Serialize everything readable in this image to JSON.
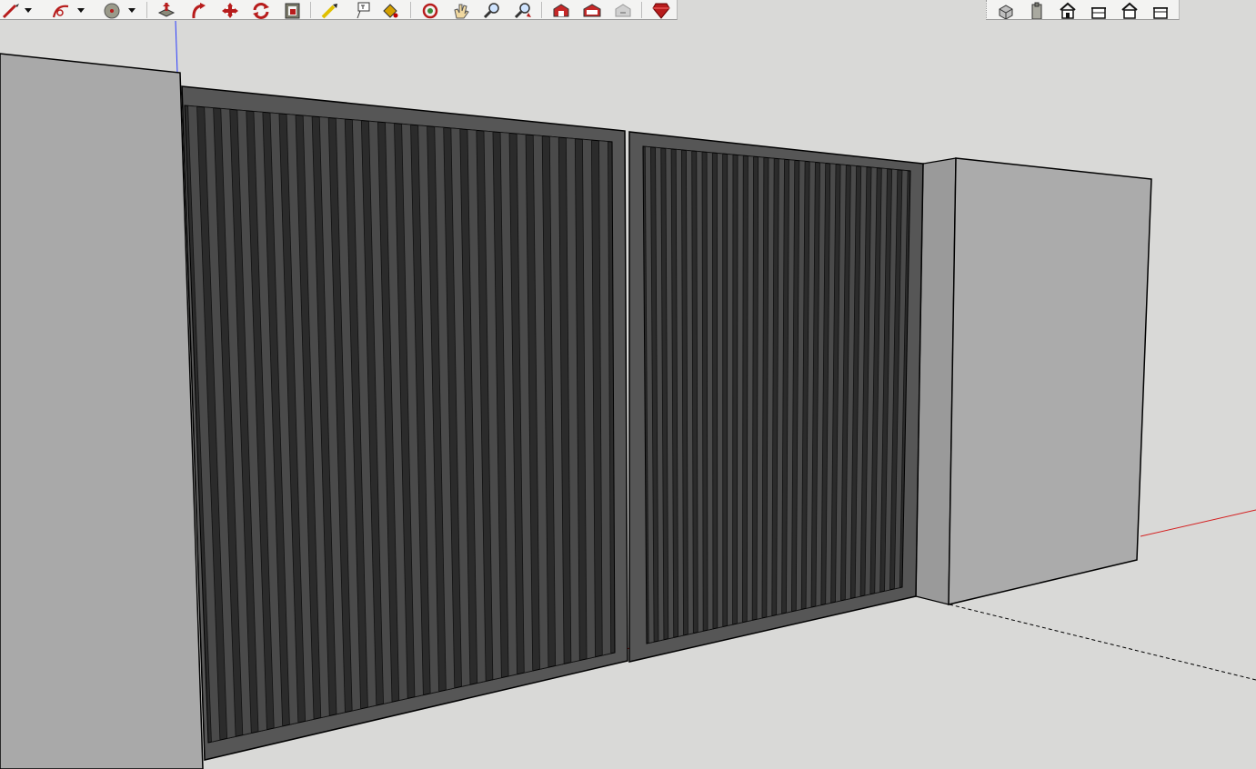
{
  "app": {
    "accent_red": "#b71c1c",
    "axis_colors": {
      "blue": "#2a3cff",
      "red": "#d42020",
      "green_dashed": "#000000"
    }
  },
  "toolbar_left": {
    "tools": [
      {
        "name": "pencil-line-icon"
      },
      {
        "name": "dropdown-arrow-icon"
      },
      {
        "name": "arc-icon"
      },
      {
        "name": "dropdown-arrow-icon"
      },
      {
        "name": "circle-icon"
      },
      {
        "name": "dropdown-arrow-icon"
      },
      {
        "name": "push-pull-icon"
      },
      {
        "name": "follow-me-icon"
      },
      {
        "name": "move-icon"
      },
      {
        "name": "rotate-icon"
      },
      {
        "name": "offset-icon"
      },
      {
        "name": "tape-measure-icon"
      },
      {
        "name": "text-icon"
      },
      {
        "name": "paint-bucket-icon"
      },
      {
        "name": "orbit-icon"
      },
      {
        "name": "pan-icon"
      },
      {
        "name": "zoom-icon"
      },
      {
        "name": "zoom-extents-icon"
      },
      {
        "name": "warehouse-icon"
      },
      {
        "name": "extension-warehouse-icon"
      },
      {
        "name": "share-model-icon"
      },
      {
        "name": "ruby-icon"
      }
    ]
  },
  "toolbar_right": {
    "tools": [
      {
        "name": "iso-view-icon"
      },
      {
        "name": "top-view-icon"
      },
      {
        "name": "front-view-icon"
      },
      {
        "name": "right-view-icon"
      },
      {
        "name": "back-view-icon"
      },
      {
        "name": "left-view-icon"
      }
    ]
  },
  "scene": {
    "left_pillar_color": "#a9a9a9",
    "right_pillar_front": "#ababab",
    "right_pillar_side": "#9a9a9a",
    "gate_frame": "#565656",
    "gate_infill": "#2b2b2b",
    "slat": "#4a4a4a"
  }
}
